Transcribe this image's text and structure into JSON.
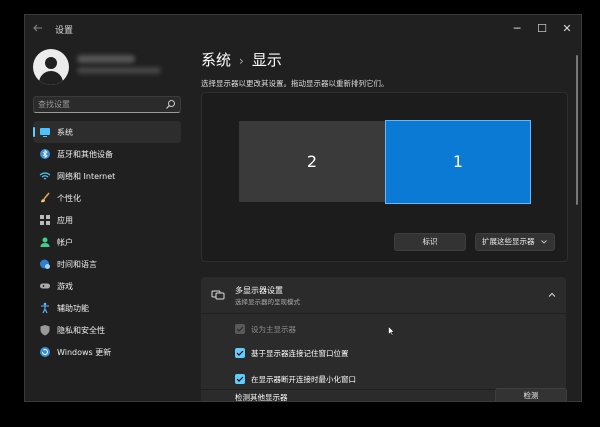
{
  "window": {
    "title": "设置",
    "controls": {
      "minimize": "─",
      "maximize": "☐",
      "close": "✕"
    }
  },
  "search": {
    "placeholder": "查找设置",
    "value": ""
  },
  "sidebar": {
    "items": [
      {
        "label": "系统",
        "icon": "monitor-icon",
        "color": "#4cc2ff",
        "active": true
      },
      {
        "label": "蓝牙和其他设备",
        "icon": "bluetooth-icon",
        "color": "#4cc2ff"
      },
      {
        "label": "网络和 Internet",
        "icon": "wifi-icon",
        "color": "#4cc2ff"
      },
      {
        "label": "个性化",
        "icon": "brush-icon",
        "color": "#e8a060"
      },
      {
        "label": "应用",
        "icon": "apps-icon",
        "color": "#b7b7b7"
      },
      {
        "label": "帐户",
        "icon": "person-icon",
        "color": "#3ecf8e"
      },
      {
        "label": "时间和语言",
        "icon": "globe-clock-icon",
        "color": "#4cc2ff"
      },
      {
        "label": "游戏",
        "icon": "gamepad-icon",
        "color": "#b7b7b7"
      },
      {
        "label": "辅助功能",
        "icon": "accessibility-icon",
        "color": "#5fb8ff"
      },
      {
        "label": "隐私和安全性",
        "icon": "shield-icon",
        "color": "#b7b7b7"
      },
      {
        "label": "Windows 更新",
        "icon": "update-icon",
        "color": "#4cc2ff"
      }
    ]
  },
  "main": {
    "breadcrumb": {
      "parent": "系统",
      "separator": "›",
      "current": "显示"
    },
    "description": "选择显示器以更改其设置。拖动显示器以重新排列它们。",
    "monitors": [
      {
        "label": "2"
      },
      {
        "label": "1"
      }
    ],
    "identify_label": "标识",
    "extend_label": "扩展这些显示器",
    "multi_display": {
      "title": "多显示器设置",
      "subtitle": "选择显示器的呈现模式",
      "options": [
        {
          "label": "设为主显示器",
          "checked": true,
          "disabled": true
        },
        {
          "label": "基于显示器连接记住窗口位置",
          "checked": true,
          "disabled": false
        },
        {
          "label": "在显示器断开连接时最小化窗口",
          "checked": true,
          "disabled": false
        }
      ],
      "detect_label": "检测其他显示器",
      "detect_button": "检测"
    }
  },
  "colors": {
    "accent": "#60cdff",
    "selected_monitor": "#0a7ad4"
  }
}
